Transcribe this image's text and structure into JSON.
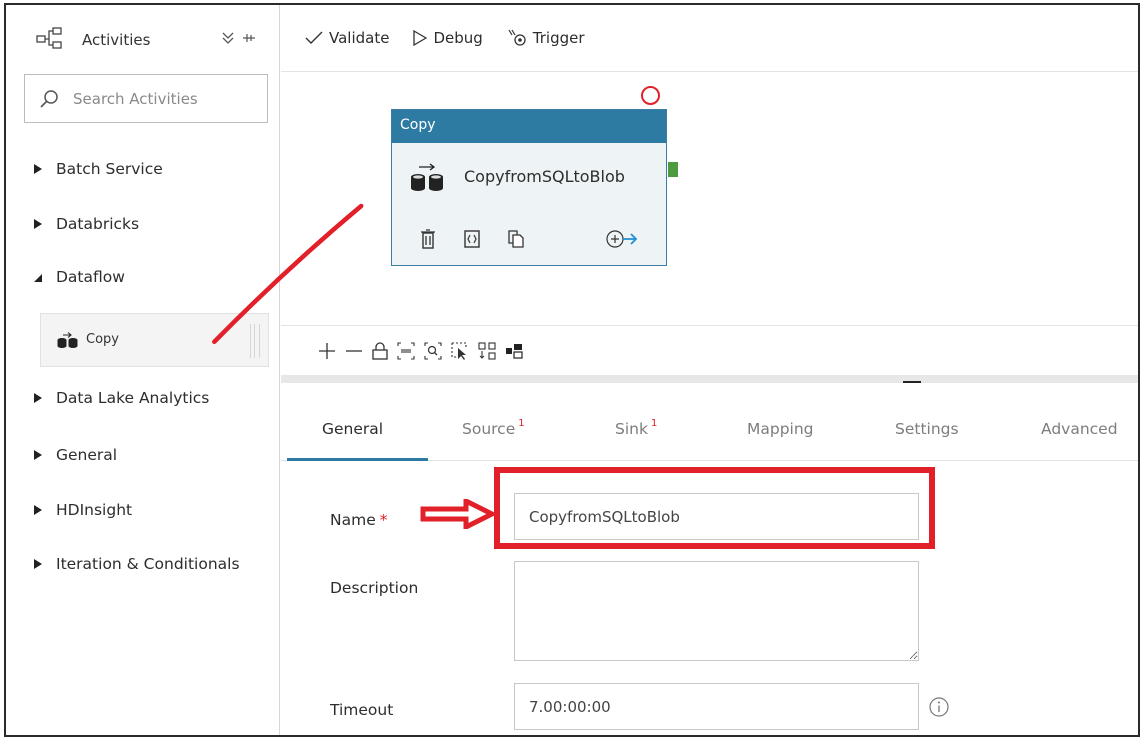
{
  "sidebar": {
    "title": "Activities",
    "search_placeholder": "Search Activities",
    "categories": [
      {
        "label": "Batch Service",
        "expanded": false
      },
      {
        "label": "Databricks",
        "expanded": false
      },
      {
        "label": "Dataflow",
        "expanded": true
      },
      {
        "label": "Data Lake Analytics",
        "expanded": false
      },
      {
        "label": "General",
        "expanded": false
      },
      {
        "label": "HDInsight",
        "expanded": false
      },
      {
        "label": "Iteration & Conditionals",
        "expanded": false
      }
    ],
    "dataflow_items": [
      {
        "label": "Copy",
        "icon": "copy-activity-icon"
      }
    ]
  },
  "toolbar": {
    "validate_label": "Validate",
    "debug_label": "Debug",
    "trigger_label": "Trigger"
  },
  "canvas": {
    "node": {
      "type_label": "Copy",
      "name": "CopyfromSQLtoBlob",
      "actions": [
        "delete-icon",
        "code-icon",
        "clone-icon",
        "add-output-icon"
      ]
    },
    "tools": [
      "zoom-in-icon",
      "zoom-out-icon",
      "lock-icon",
      "zoom-100-icon",
      "zoom-to-fit-icon",
      "select-icon",
      "auto-align-icon",
      "minimap-icon"
    ]
  },
  "tabs": [
    {
      "label": "General",
      "badge": "",
      "active": true
    },
    {
      "label": "Source",
      "badge": "1",
      "active": false
    },
    {
      "label": "Sink",
      "badge": "1",
      "active": false
    },
    {
      "label": "Mapping",
      "badge": "",
      "active": false
    },
    {
      "label": "Settings",
      "badge": "",
      "active": false
    },
    {
      "label": "Advanced",
      "badge": "",
      "active": false
    }
  ],
  "form": {
    "name_label": "Name",
    "name_required_mark": "*",
    "name_value": "CopyfromSQLtoBlob",
    "description_label": "Description",
    "description_value": "",
    "timeout_label": "Timeout",
    "timeout_value": "7.00:00:00"
  },
  "colors": {
    "accent": "#2d7aa2",
    "annotation_red": "#e2202a",
    "success_port": "#4e9a3e"
  }
}
